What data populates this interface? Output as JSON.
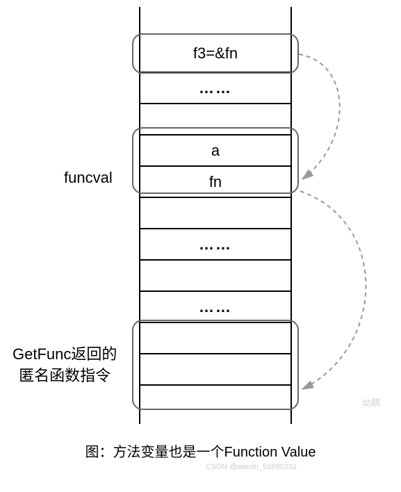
{
  "stack": {
    "top_cell": "f3=&fn",
    "ellipsis": "……",
    "funcval_a": "a",
    "funcval_fn": "fn"
  },
  "labels": {
    "funcval": "funcval",
    "getfunc_line1": "GetFunc返回的",
    "getfunc_line2": "匿名函数指令"
  },
  "caption": "图：方法变量也是一个Function Value",
  "watermark": "幼麟",
  "attribution": "CSDN @weixin_52690231"
}
